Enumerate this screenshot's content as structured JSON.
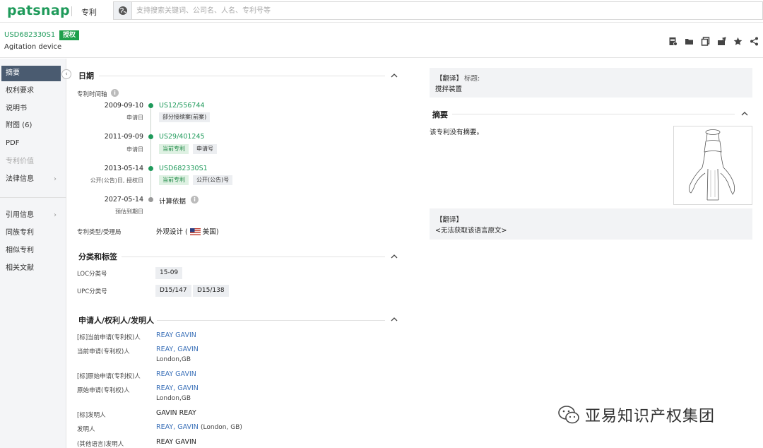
{
  "topbar": {
    "logo": "patsnap",
    "module": "专利",
    "search_placeholder": "支持搜索关键词、公司名、人名、专利号等"
  },
  "header": {
    "patent_number": "USD682330S1",
    "status_badge": "授权",
    "title": "Agitation device",
    "colors": {
      "brand": "#1e9a5a",
      "badge": "#1ea04c",
      "link": "#3a70b8"
    }
  },
  "sidebar": {
    "items": [
      {
        "label": "摘要"
      },
      {
        "label": "权利要求"
      },
      {
        "label": "说明书"
      },
      {
        "label": "附图 (6)"
      },
      {
        "label": "PDF"
      },
      {
        "label": "专利价值"
      },
      {
        "label": "法律信息"
      },
      {
        "label": "引用信息"
      },
      {
        "label": "同族专利"
      },
      {
        "label": "相似专利"
      },
      {
        "label": "相关文献"
      }
    ]
  },
  "dates": {
    "section_title": "日期",
    "timeline_label": "专利时间轴",
    "events": [
      {
        "date": "2009-09-10",
        "sub": "申请日",
        "number": "US12/556744",
        "tags": [
          "部分接续案(前案)"
        ]
      },
      {
        "date": "2011-09-09",
        "sub": "申请日",
        "number": "US29/401245",
        "tags": [
          "当前专利",
          "申请号"
        ]
      },
      {
        "date": "2013-05-14",
        "sub": "公开(公告)日, 授权日",
        "number": "USD682330S1",
        "tags": [
          "当前专利",
          "公开(公告)号"
        ]
      },
      {
        "date": "2027-05-14",
        "sub": "预估到期日",
        "number": "计算依据",
        "tags": []
      }
    ],
    "type_label": "专利类型/受理局",
    "type_value_prefix": "外观设计 (",
    "type_value_country": "美国",
    "type_value_suffix": ")"
  },
  "classification": {
    "section_title": "分类和标签",
    "loc_label": "LOC分类号",
    "loc_values": [
      "15-09"
    ],
    "upc_label": "UPC分类号",
    "upc_values": [
      "D15/147",
      "D15/138"
    ]
  },
  "parties": {
    "section_title": "申请人/权利人/发明人",
    "rows": [
      {
        "label": "[标]当前申请(专利权)人",
        "value": "REAY GAVIN",
        "sub": ""
      },
      {
        "label": "当前申请(专利权)人",
        "value": "REAY, GAVIN",
        "sub": "London,GB"
      },
      {
        "label": "[标]原始申请(专利权)人",
        "value": "REAY GAVIN",
        "sub": ""
      },
      {
        "label": "原始申请(专利权)人",
        "value": "REAY, GAVIN",
        "sub": "London,GB"
      },
      {
        "label": "[标]发明人",
        "value": "GAVIN REAY",
        "sub": ""
      },
      {
        "label": "发明人",
        "value": "REAY, GAVIN",
        "sub": "(London, GB)"
      },
      {
        "label": "(其他语言)发明人",
        "value": "REAY GAVIN",
        "sub": ""
      }
    ]
  },
  "right": {
    "translate_title_label": "【翻译】",
    "title_caption": "标题:",
    "title_translation": "搅拌装置",
    "abstract_title": "摘要",
    "abstract_text": "该专利没有摘要。",
    "translate_box_label": "【翻译】",
    "translate_box_text": "<无法获取该语言原文>"
  },
  "watermark": "亚易知识产权集团",
  "icons": [
    "globe-icon",
    "add-note-icon",
    "folder-icon",
    "copy-icon",
    "share-box-icon",
    "star-icon",
    "share-icon",
    "collapse-arrow-icon",
    "info-icon",
    "us-flag-icon",
    "chevron-up-icon",
    "chevron-right-icon",
    "wechat-icon"
  ]
}
